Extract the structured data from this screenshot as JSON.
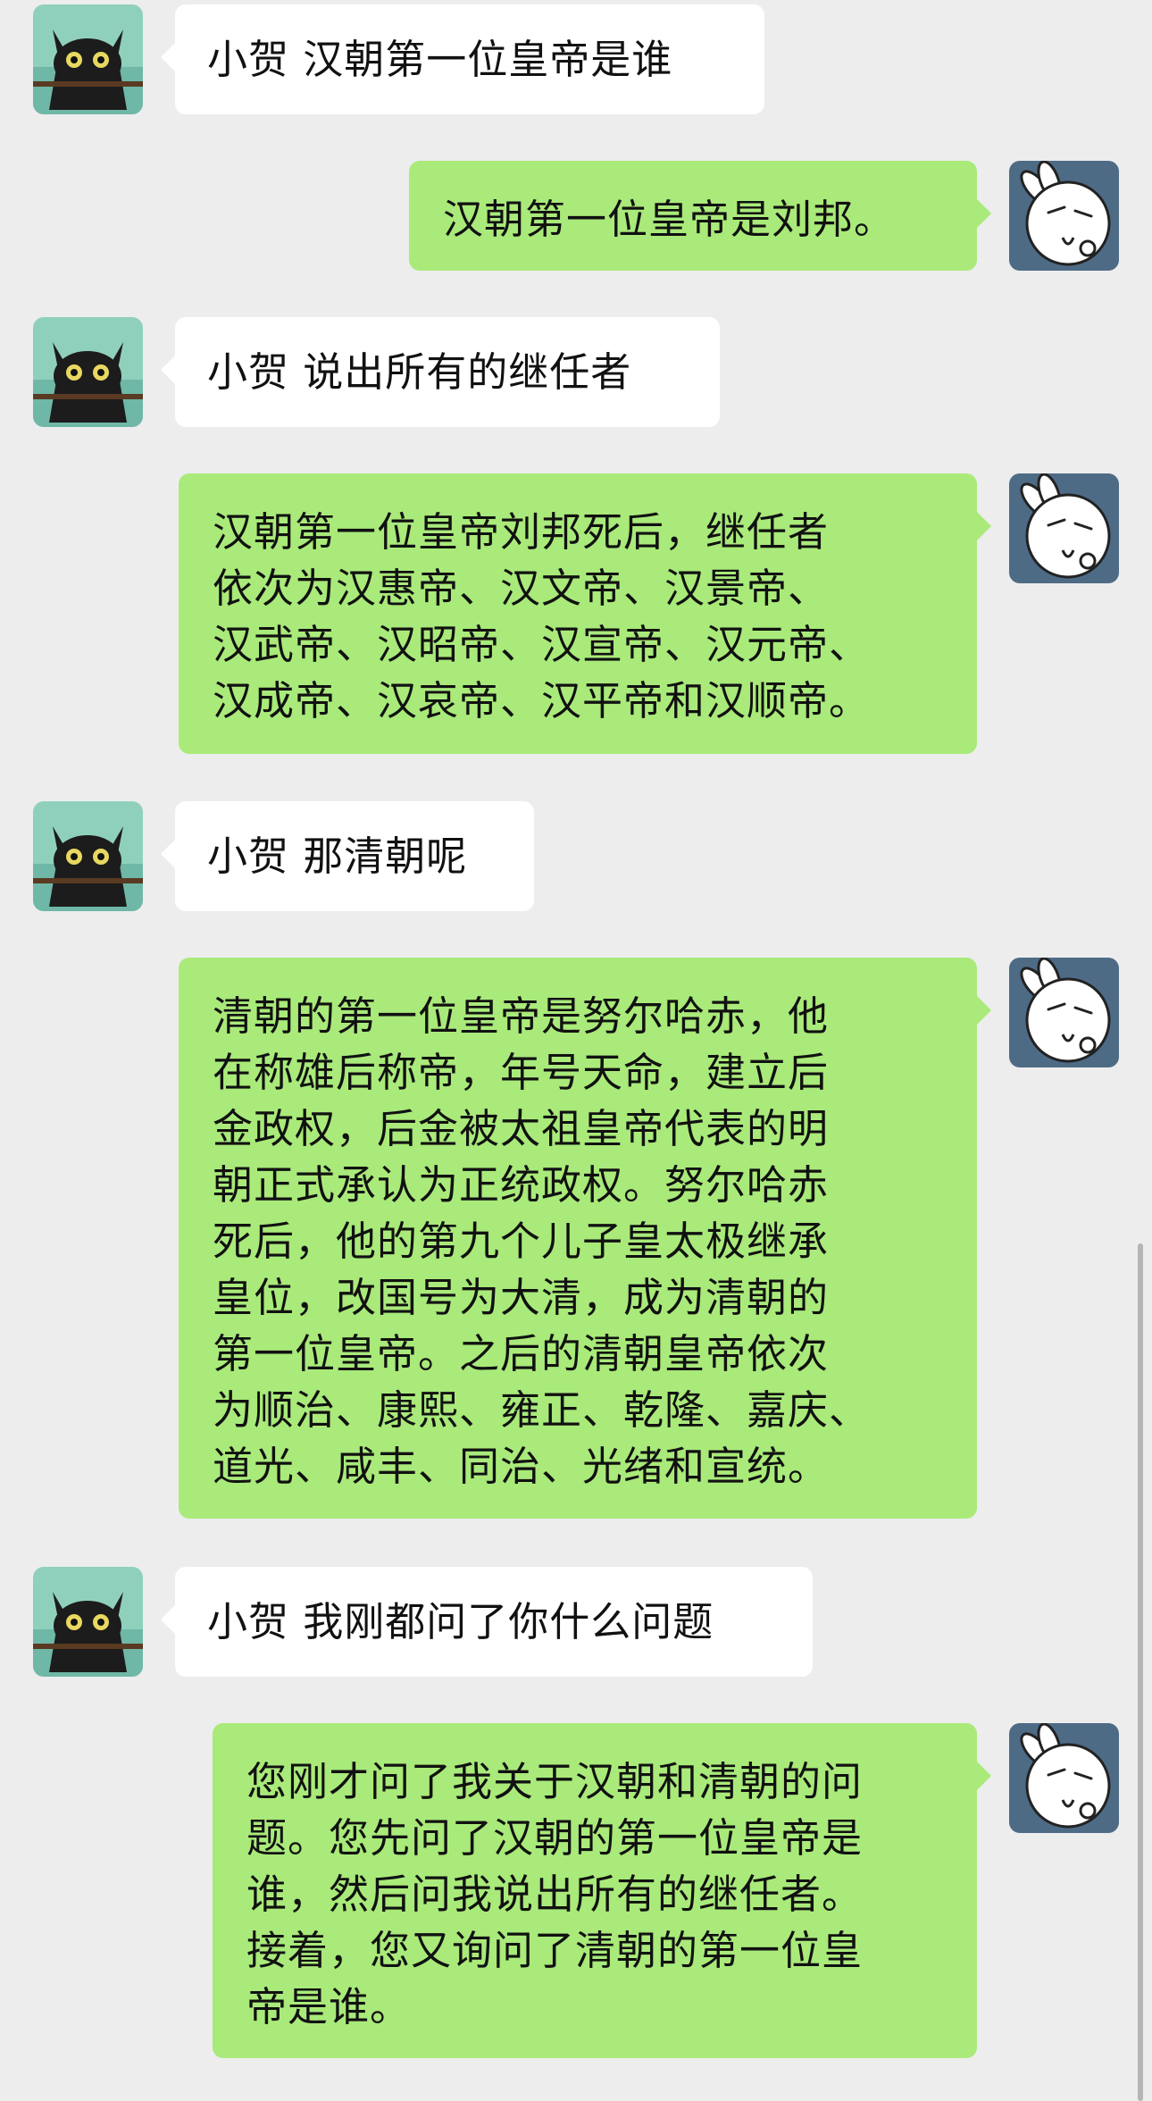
{
  "colors": {
    "background": "#ededed",
    "incoming_bubble": "#ffffff",
    "outgoing_bubble": "#a9ea7a"
  },
  "icons": {
    "user_avatar": "black-cat-avatar",
    "bot_avatar": "rabbit-face-avatar"
  },
  "messages": [
    {
      "from": "user",
      "text": "小贺 汉朝第一位皇帝是谁"
    },
    {
      "from": "bot",
      "text": "汉朝第一位皇帝是刘邦。"
    },
    {
      "from": "user",
      "text": "小贺 说出所有的继任者"
    },
    {
      "from": "bot",
      "text": "汉朝第一位皇帝刘邦死后，继任者\n依次为汉惠帝、汉文帝、汉景帝、\n汉武帝、汉昭帝、汉宣帝、汉元帝、\n汉成帝、汉哀帝、汉平帝和汉顺帝。"
    },
    {
      "from": "user",
      "text": "小贺 那清朝呢"
    },
    {
      "from": "bot",
      "text": "清朝的第一位皇帝是努尔哈赤，他\n在称雄后称帝，年号天命，建立后\n金政权，后金被太祖皇帝代表的明\n朝正式承认为正统政权。努尔哈赤\n死后，他的第九个儿子皇太极继承\n皇位，改国号为大清，成为清朝的\n第一位皇帝。之后的清朝皇帝依次\n为顺治、康熙、雍正、乾隆、嘉庆、\n道光、咸丰、同治、光绪和宣统。"
    },
    {
      "from": "user",
      "text": "小贺 我刚都问了你什么问题"
    },
    {
      "from": "bot",
      "text": "您刚才问了我关于汉朝和清朝的问\n题。您先问了汉朝的第一位皇帝是\n谁，然后问我说出所有的继任者。\n接着，您又询问了清朝的第一位皇\n帝是谁。"
    }
  ]
}
